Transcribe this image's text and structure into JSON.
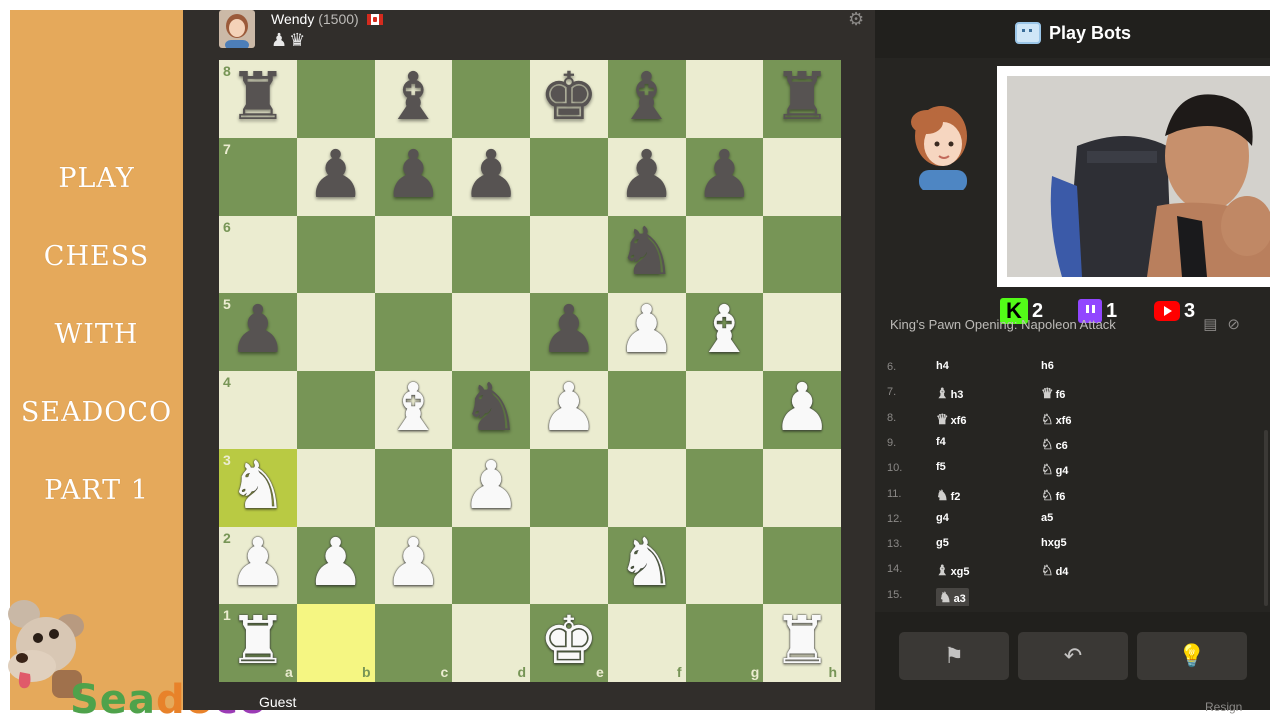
{
  "stream": {
    "lines": [
      "PLAY",
      "CHESS",
      "WITH",
      "SEADOCO",
      "PART 1"
    ],
    "brand_parts": [
      "Sea",
      "do",
      "co"
    ]
  },
  "opponent": {
    "name": "Wendy",
    "rating": "(1500)",
    "captured": "♟♛"
  },
  "board": {
    "rows": [
      [
        "br",
        "",
        "bb",
        "",
        "bk",
        "bb",
        "",
        "br"
      ],
      [
        "",
        "bp",
        "bp",
        "bp",
        "",
        "bp",
        "bp",
        ""
      ],
      [
        "",
        "",
        "",
        "",
        "",
        "bn",
        "",
        ""
      ],
      [
        "bp",
        "",
        "",
        "",
        "bp",
        "wp",
        "wb",
        ""
      ],
      [
        "",
        "",
        "wb",
        "bn",
        "wp",
        "",
        "",
        "wp"
      ],
      [
        "wn",
        "",
        "",
        "wp",
        "",
        "",
        "",
        ""
      ],
      [
        "wp",
        "wp",
        "wp",
        "",
        "",
        "wn",
        "",
        ""
      ],
      [
        "wr",
        "",
        "",
        "",
        "wk",
        "",
        "",
        "wr"
      ]
    ],
    "highlight": [
      "a3",
      "b1"
    ],
    "ranks": [
      "8",
      "7",
      "6",
      "5",
      "4",
      "3",
      "2",
      "1"
    ],
    "files": [
      "a",
      "b",
      "c",
      "d",
      "e",
      "f",
      "g",
      "h"
    ]
  },
  "bottom_player": {
    "name": "Guest"
  },
  "panel": {
    "title": "Play Bots",
    "opening": "King's Pawn Opening: Napoleon Attack",
    "social": {
      "kick": "2",
      "twitch": "1",
      "youtube": "3"
    },
    "moves": [
      {
        "num": "6.",
        "w": "h4",
        "wi": "",
        "b": "h6",
        "bi": ""
      },
      {
        "num": "7.",
        "w": "h3",
        "wi": "♝",
        "b": "f6",
        "bi": "♛"
      },
      {
        "num": "8.",
        "w": "xf6",
        "wi": "♛",
        "b": "xf6",
        "bi": "♘"
      },
      {
        "num": "9.",
        "w": "f4",
        "wi": "",
        "b": "c6",
        "bi": "♘"
      },
      {
        "num": "10.",
        "w": "f5",
        "wi": "",
        "b": "g4",
        "bi": "♘"
      },
      {
        "num": "11.",
        "w": "f2",
        "wi": "♞",
        "b": "f6",
        "bi": "♘"
      },
      {
        "num": "12.",
        "w": "g4",
        "wi": "",
        "b": "a5",
        "bi": ""
      },
      {
        "num": "13.",
        "w": "g5",
        "wi": "",
        "b": "hxg5",
        "bi": ""
      },
      {
        "num": "14.",
        "w": "xg5",
        "wi": "♝",
        "b": "d4",
        "bi": "♘"
      },
      {
        "num": "15.",
        "w": "a3",
        "wi": "♞",
        "b": "",
        "bi": ""
      }
    ],
    "controls": [
      "⚑",
      "↶",
      "💡"
    ],
    "resign_label": "Resign"
  }
}
